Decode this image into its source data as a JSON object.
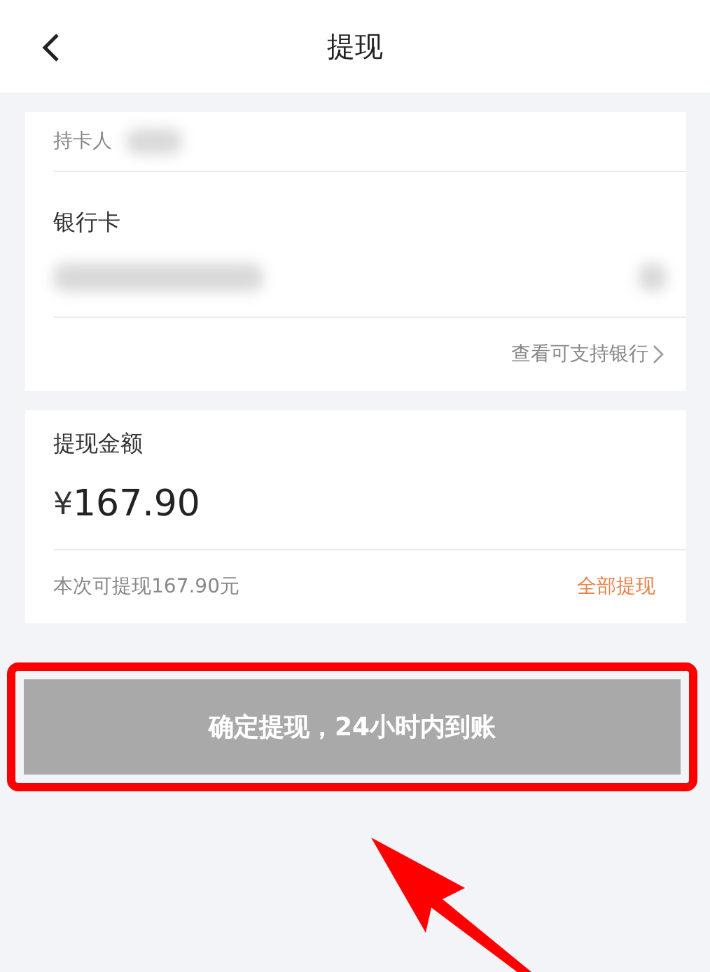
{
  "header": {
    "title": "提现"
  },
  "card": {
    "holder_label": "持卡人",
    "bank_label": "银行卡",
    "supported_banks_link": "查看可支持银行"
  },
  "amount": {
    "label": "提现金额",
    "currency": "¥",
    "value": "167.90",
    "available": "本次可提现167.90元",
    "withdraw_all": "全部提现"
  },
  "submit": {
    "label": "确定提现，24小时内到账",
    "disabled": true
  }
}
